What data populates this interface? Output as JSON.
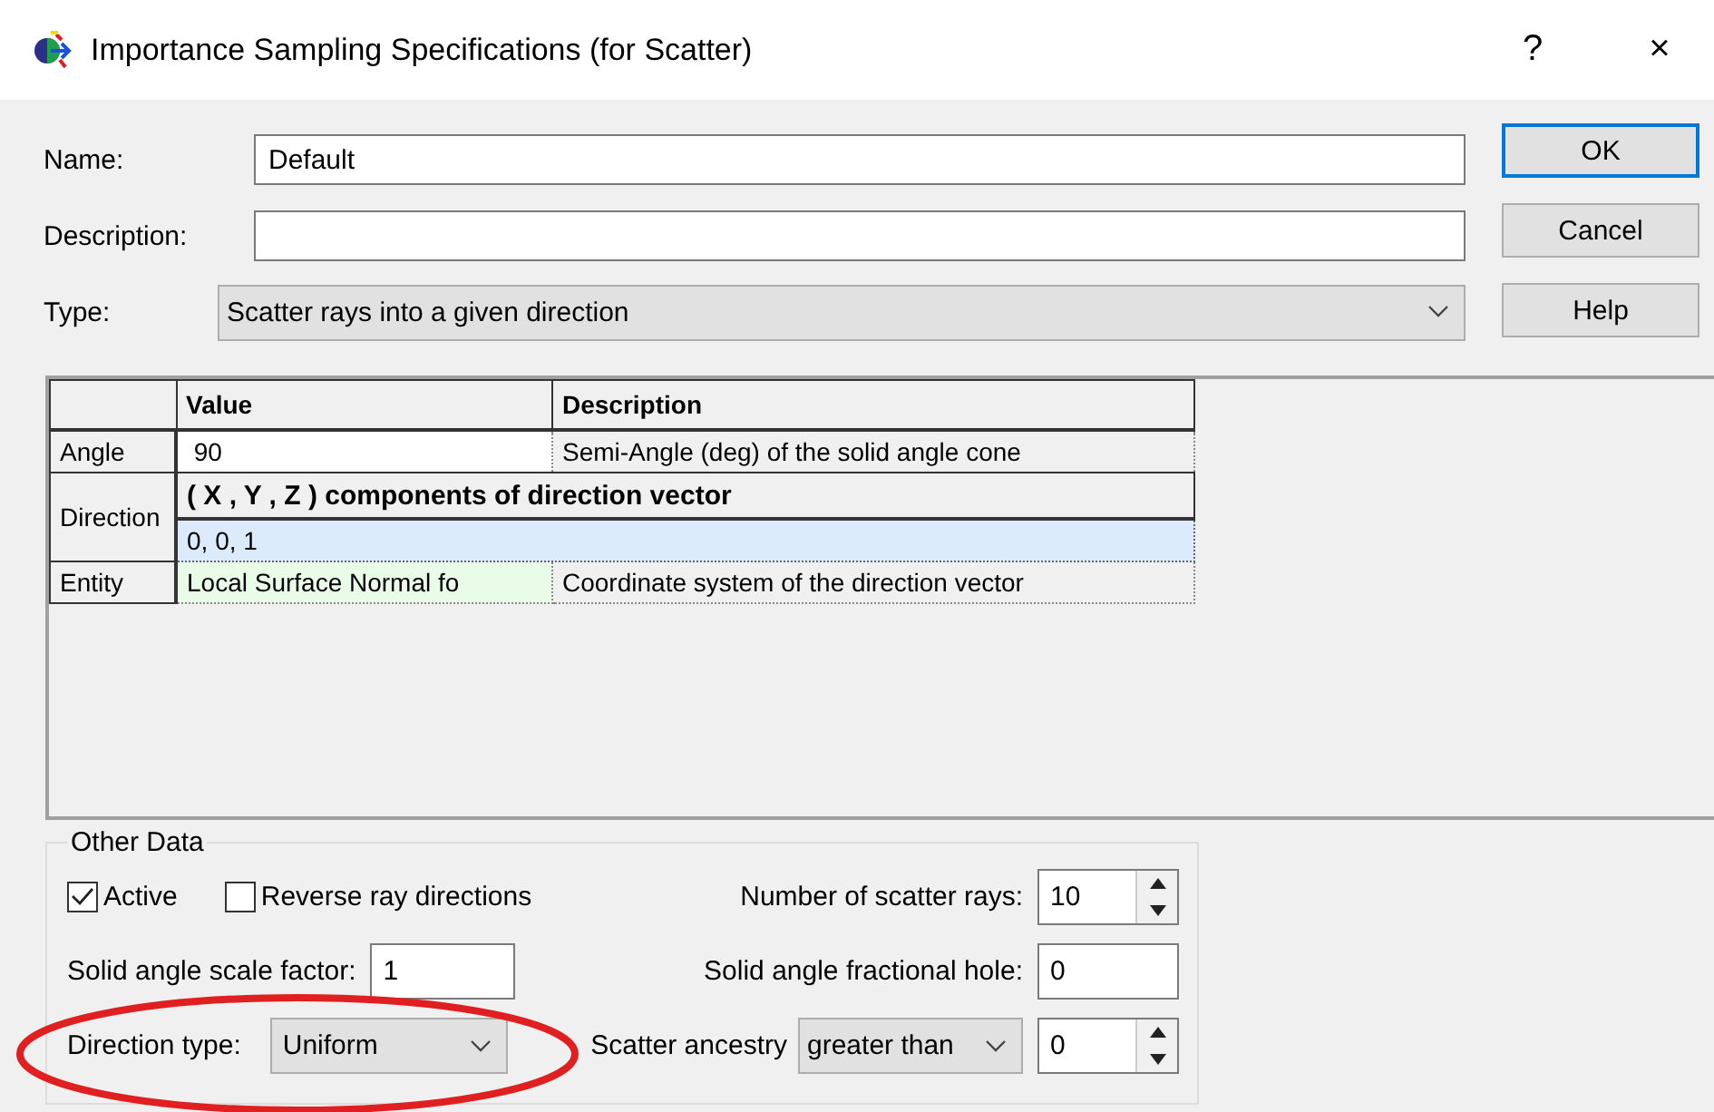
{
  "window": {
    "title": "Importance Sampling Specifications (for Scatter)",
    "help": "?",
    "close": "×"
  },
  "fields": {
    "name": {
      "label": "Name:",
      "value": "Default"
    },
    "description": {
      "label": "Description:"
    },
    "type": {
      "label": "Type:",
      "value": "Scatter rays into a given direction"
    }
  },
  "buttons": [
    {
      "label": "OK",
      "focused": true
    },
    {
      "label": "Cancel",
      "focused": false
    },
    {
      "label": "Help",
      "focused": false
    }
  ],
  "table": {
    "columns": [
      "Value",
      "Description"
    ],
    "rows": [
      {
        "kind": "text",
        "label": "Angle",
        "value": "90",
        "description": "Semi-Angle (deg) of the solid angle cone",
        "selected": false
      },
      {
        "kind": "vector",
        "label": "Direction",
        "heading": "( X , Y , Z ) components of direction vector",
        "value": "0,  0,  1",
        "selected": true
      },
      {
        "kind": "choice",
        "label": "Entity",
        "value": "Local Surface Normal fo",
        "description": "Coordinate system of the direction vector",
        "selected": false
      }
    ]
  },
  "other_data": {
    "title": "Other Data",
    "checkboxes": [
      {
        "label": "Active",
        "checked": true
      },
      {
        "label": "Reverse ray directions",
        "checked": false
      }
    ],
    "scatter_rays": {
      "label": "Number of scatter rays:",
      "value": "10"
    },
    "scale_factor": {
      "label": "Solid angle scale factor:",
      "value": "1"
    },
    "fractional_hole": {
      "label": "Solid angle fractional hole:",
      "value": "0"
    },
    "direction_type": {
      "label": "Direction type:",
      "value": "Uniform"
    },
    "scatter_ancestry": {
      "label": "Scatter ancestry",
      "value": "greater than",
      "count": "0"
    }
  }
}
